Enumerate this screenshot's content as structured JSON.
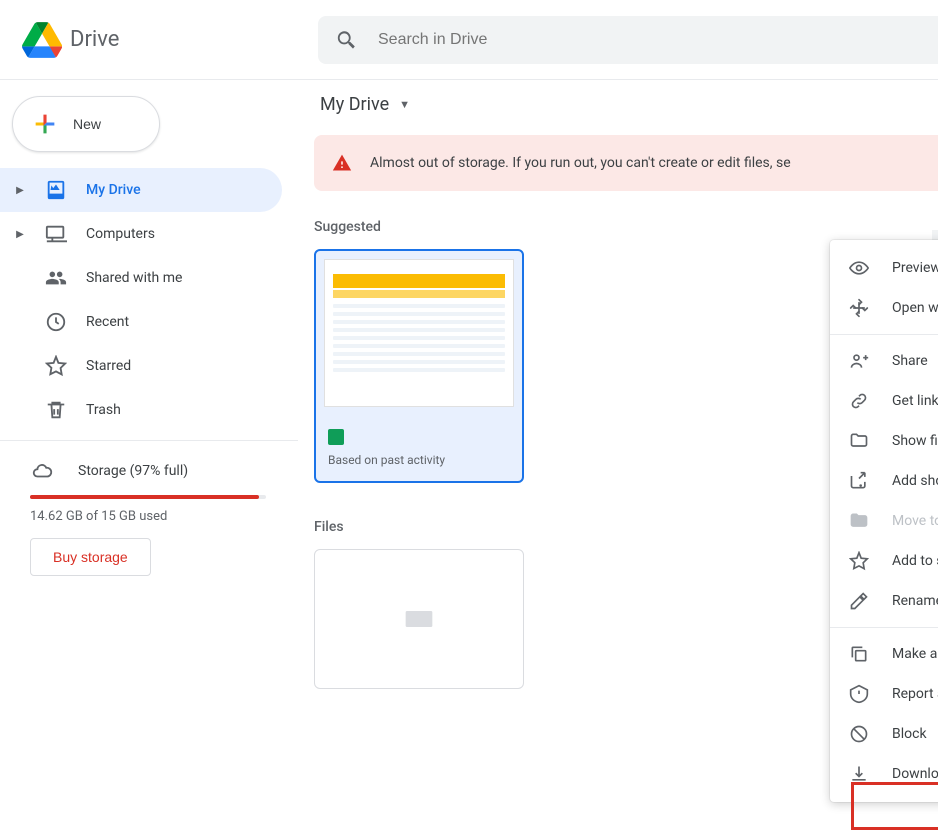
{
  "header": {
    "app_name": "Drive",
    "search_placeholder": "Search in Drive"
  },
  "sidebar": {
    "new_label": "New",
    "items": [
      {
        "label": "My Drive"
      },
      {
        "label": "Computers"
      },
      {
        "label": "Shared with me"
      },
      {
        "label": "Recent"
      },
      {
        "label": "Starred"
      },
      {
        "label": "Trash"
      }
    ],
    "storage": {
      "label": "Storage (97% full)",
      "used_text": "14.62 GB of 15 GB used",
      "buy_label": "Buy storage"
    }
  },
  "main": {
    "breadcrumb": "My Drive",
    "banner_text": "Almost out of storage. If you run out, you can't create or edit files, se",
    "suggested_title": "Suggested",
    "suggested_card": {
      "subtitle": "Based on past activity"
    },
    "files_title": "Files"
  },
  "context_menu": {
    "items": [
      {
        "label": "Preview",
        "icon": "eye"
      },
      {
        "label": "Open with",
        "icon": "open-with",
        "chevron": true
      }
    ],
    "items2": [
      {
        "label": "Share",
        "icon": "share"
      },
      {
        "label": "Get link",
        "icon": "link"
      },
      {
        "label": "Show file location",
        "icon": "folder"
      },
      {
        "label": "Add shortcut to Drive",
        "icon": "shortcut"
      },
      {
        "label": "Move to",
        "icon": "moveto",
        "disabled": true
      },
      {
        "label": "Add to starred",
        "icon": "star"
      },
      {
        "label": "Rename",
        "icon": "rename"
      }
    ],
    "items3": [
      {
        "label": "Make a copy",
        "icon": "copy"
      },
      {
        "label": "Report abuse",
        "icon": "report"
      },
      {
        "label": "Block",
        "icon": "block"
      },
      {
        "label": "Download",
        "icon": "download"
      }
    ]
  }
}
